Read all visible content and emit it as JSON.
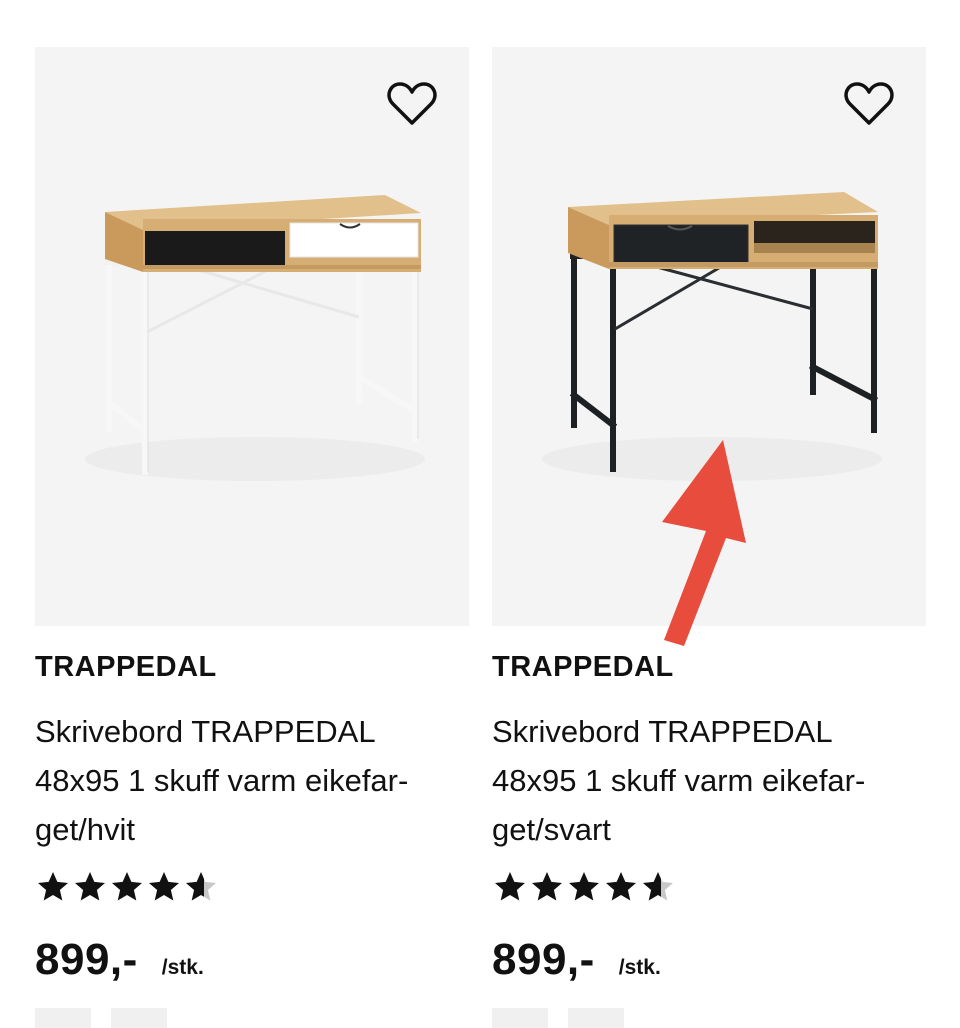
{
  "products": [
    {
      "brand": "TRAPPEDAL",
      "title": "Skrivebord TRAPPEDAL 48x95 1 skuff varm eikefar-get/hvit",
      "rating": 4.5,
      "rating_max": 5,
      "price": "899,-",
      "unit": "/stk.",
      "frame_color": "#f5f5f5",
      "drawer_color": "#ffffff"
    },
    {
      "brand": "TRAPPEDAL",
      "title": "Skrivebord TRAPPEDAL 48x95 1 skuff varm eikefar-get/svart",
      "rating": 4.5,
      "rating_max": 5,
      "price": "899,-",
      "unit": "/stk.",
      "frame_color": "#1e2124",
      "drawer_color": "#1f2326"
    }
  ],
  "colors": {
    "image_bg": "#f4f4f4",
    "wood": "#d6ad73",
    "annotation_arrow": "#e84c3d"
  },
  "icons": {
    "favorite": "heart-outline-icon",
    "rating": "star-icon",
    "annotation": "arrow-annotation"
  }
}
